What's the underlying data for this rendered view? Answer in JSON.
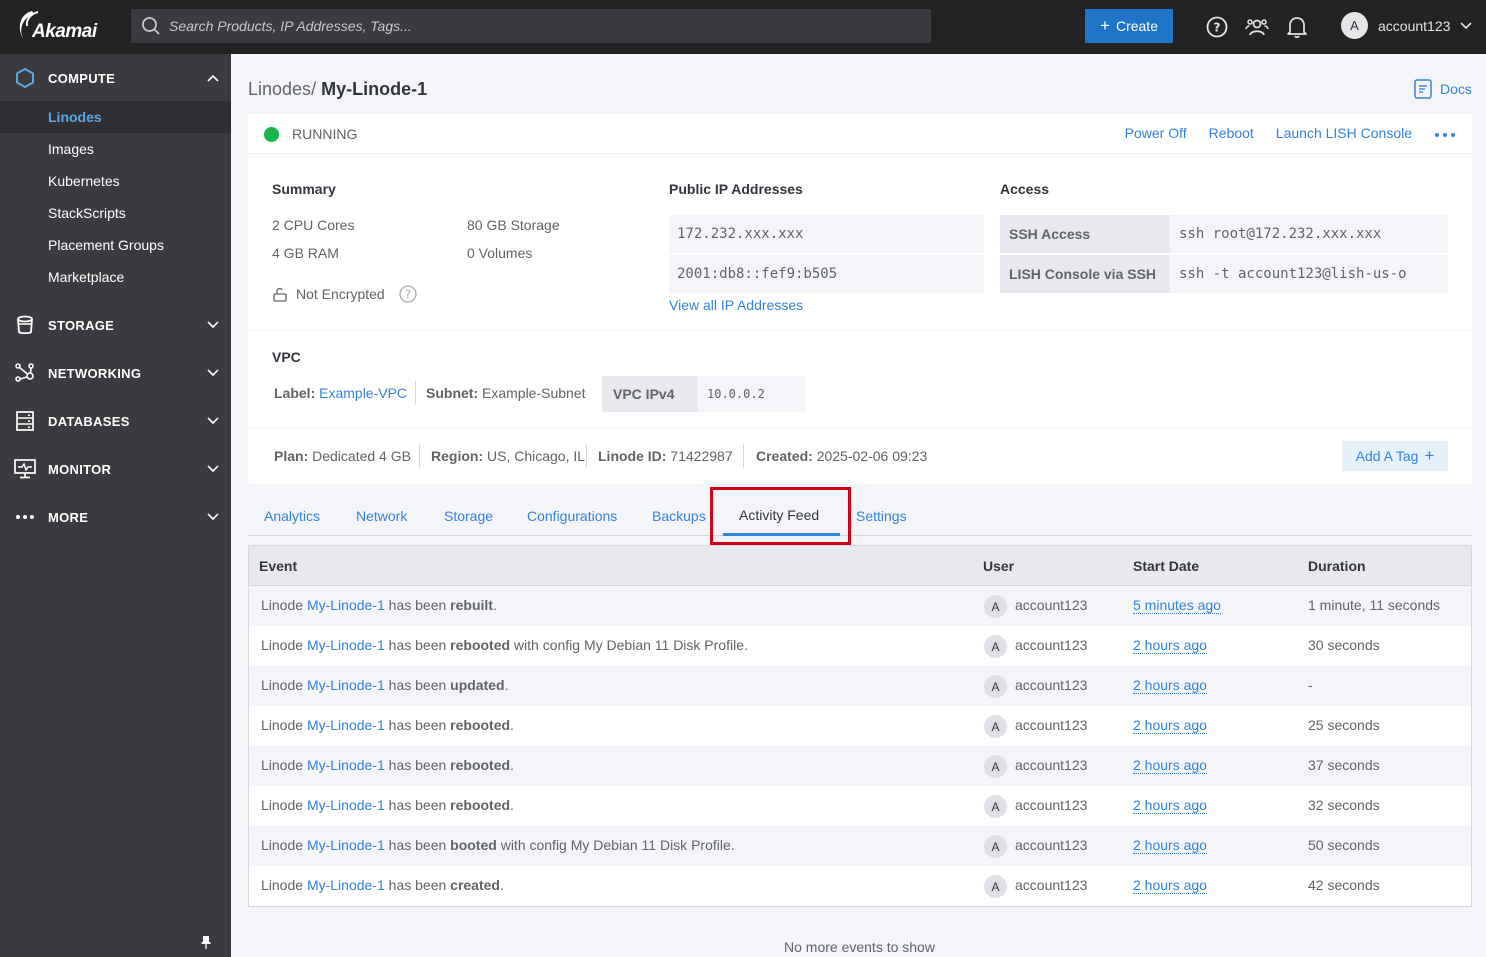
{
  "topbar": {
    "logo_text": "Akamai",
    "search_placeholder": "Search Products, IP Addresses, Tags...",
    "create_label": "Create",
    "account_initial": "A",
    "account_name": "account123",
    "icons": [
      "help-icon",
      "community-icon",
      "notifications-icon"
    ]
  },
  "sidebar": {
    "groups": [
      {
        "label": "COMPUTE",
        "icon": "hexagon-icon",
        "expanded": true
      },
      {
        "label": "STORAGE",
        "icon": "bucket-icon",
        "expanded": false
      },
      {
        "label": "NETWORKING",
        "icon": "network-icon",
        "expanded": false
      },
      {
        "label": "DATABASES",
        "icon": "database-icon",
        "expanded": false
      },
      {
        "label": "MONITOR",
        "icon": "monitor-icon",
        "expanded": false
      },
      {
        "label": "MORE",
        "icon": "more-icon",
        "expanded": false
      }
    ],
    "compute_items": [
      {
        "label": "Linodes",
        "active": true
      },
      {
        "label": "Images"
      },
      {
        "label": "Kubernetes"
      },
      {
        "label": "StackScripts"
      },
      {
        "label": "Placement Groups"
      },
      {
        "label": "Marketplace"
      }
    ]
  },
  "breadcrumb": {
    "parent": "Linodes",
    "separator": "/",
    "current": "My-Linode-1"
  },
  "docs_label": "Docs",
  "status": {
    "text": "RUNNING",
    "color": "#17b54a",
    "actions": [
      "Power Off",
      "Reboot",
      "Launch LISH Console"
    ]
  },
  "summary": {
    "title": "Summary",
    "cpu": "2 CPU Cores",
    "storage": "80 GB Storage",
    "ram": "4 GB RAM",
    "volumes": "0 Volumes",
    "encryption": "Not Encrypted"
  },
  "public_ips": {
    "title": "Public IP Addresses",
    "ipv4": "172.232.xxx.xxx",
    "ipv6": "2001:db8::fef9:b505",
    "view_all": "View all IP Addresses"
  },
  "access": {
    "title": "Access",
    "rows": [
      {
        "label": "SSH Access",
        "value": "ssh root@172.232.xxx.xxx"
      },
      {
        "label": "LISH Console via SSH",
        "value": "ssh -t account123@lish-us-o"
      }
    ]
  },
  "vpc": {
    "title": "VPC",
    "label_key": "Label:",
    "label_value": "Example-VPC",
    "subnet_key": "Subnet:",
    "subnet_value": "Example-Subnet",
    "ipv4_key": "VPC IPv4",
    "ipv4_value": "10.0.0.2"
  },
  "meta": {
    "plan_key": "Plan:",
    "plan_value": "Dedicated 4 GB",
    "region_key": "Region:",
    "region_value": "US, Chicago, IL",
    "id_key": "Linode ID:",
    "id_value": "71422987",
    "created_key": "Created:",
    "created_value": "2025-02-06 09:23",
    "add_tag": "Add A Tag"
  },
  "tabs": [
    {
      "label": "Analytics"
    },
    {
      "label": "Network"
    },
    {
      "label": "Storage"
    },
    {
      "label": "Configurations"
    },
    {
      "label": "Backups"
    },
    {
      "label": "Activity Feed",
      "active": true
    },
    {
      "label": "Settings"
    }
  ],
  "table": {
    "headers": {
      "event": "Event",
      "user": "User",
      "start": "Start Date",
      "duration": "Duration"
    },
    "rows": [
      {
        "prefix": "Linode",
        "link": "My-Linode-1",
        "mid": "has been",
        "action": "rebuilt",
        "suffix": ".",
        "user_initial": "A",
        "user": "account123",
        "start": "5 minutes ago",
        "duration": "1 minute, 11 seconds"
      },
      {
        "prefix": "Linode",
        "link": "My-Linode-1",
        "mid": "has been",
        "action": "rebooted",
        "suffix": " with config My Debian 11 Disk Profile.",
        "user_initial": "A",
        "user": "account123",
        "start": "2 hours ago",
        "duration": "30 seconds"
      },
      {
        "prefix": "Linode",
        "link": "My-Linode-1",
        "mid": "has been",
        "action": "updated",
        "suffix": ".",
        "user_initial": "A",
        "user": "account123",
        "start": "2 hours ago",
        "duration": "-"
      },
      {
        "prefix": "Linode",
        "link": "My-Linode-1",
        "mid": "has been",
        "action": "rebooted",
        "suffix": ".",
        "user_initial": "A",
        "user": "account123",
        "start": "2 hours ago",
        "duration": "25 seconds"
      },
      {
        "prefix": "Linode",
        "link": "My-Linode-1",
        "mid": "has been",
        "action": "rebooted",
        "suffix": ".",
        "user_initial": "A",
        "user": "account123",
        "start": "2 hours ago",
        "duration": "37 seconds"
      },
      {
        "prefix": "Linode",
        "link": "My-Linode-1",
        "mid": "has been",
        "action": "rebooted",
        "suffix": ".",
        "user_initial": "A",
        "user": "account123",
        "start": "2 hours ago",
        "duration": "32 seconds"
      },
      {
        "prefix": "Linode",
        "link": "My-Linode-1",
        "mid": "has been",
        "action": "booted",
        "suffix": " with config My Debian 11 Disk Profile.",
        "user_initial": "A",
        "user": "account123",
        "start": "2 hours ago",
        "duration": "50 seconds"
      },
      {
        "prefix": "Linode",
        "link": "My-Linode-1",
        "mid": "has been",
        "action": "created",
        "suffix": ".",
        "user_initial": "A",
        "user": "account123",
        "start": "2 hours ago",
        "duration": "42 seconds"
      }
    ],
    "footer": "No more events to show"
  },
  "colors": {
    "accent": "#3683dc",
    "create": "#1f74c7",
    "highlight": "#d0021b",
    "sidebar": "#3a3a3f",
    "topbar": "#232326"
  }
}
